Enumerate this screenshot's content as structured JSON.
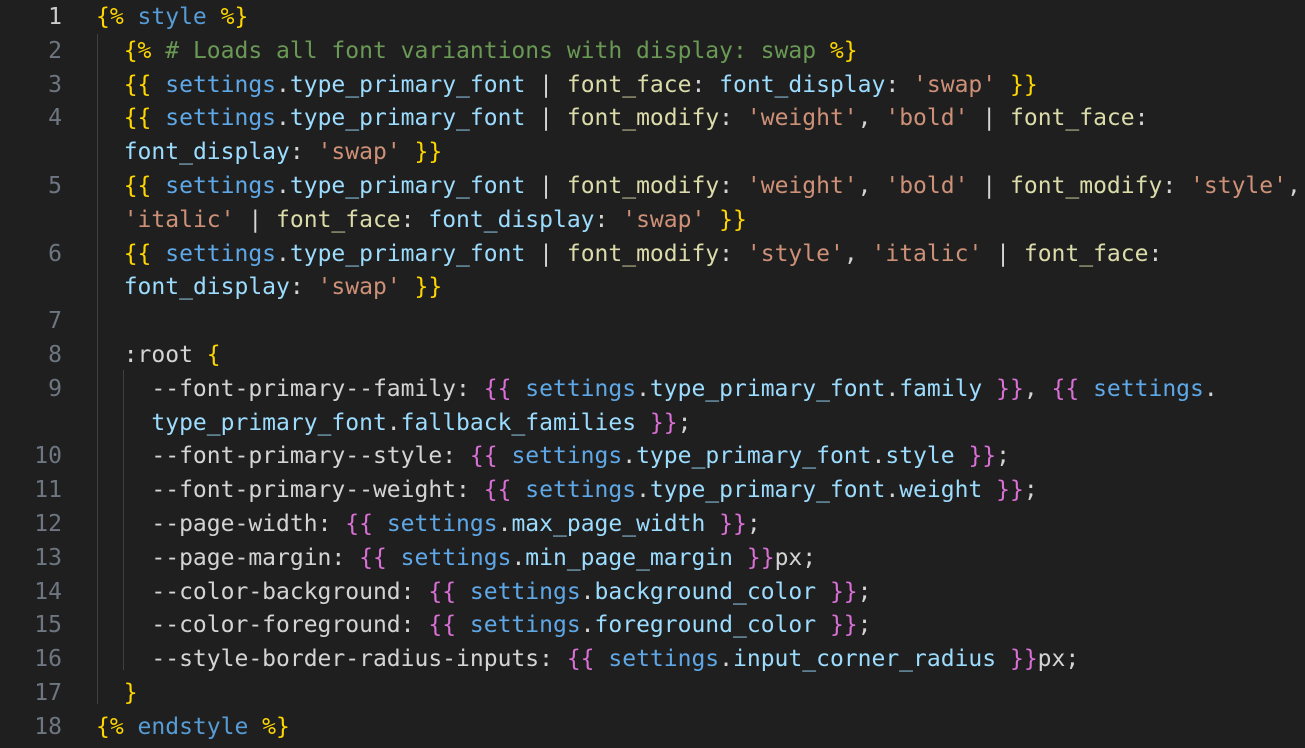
{
  "editor": {
    "colors": {
      "background": "#1f1f1f",
      "line_number": "#6e7681",
      "active_line_number": "#cccccc",
      "bracket_yellow": "#ffd700",
      "bracket_pink": "#da70d6",
      "keyword_blue": "#569cd6",
      "string": "#ce9178",
      "comment": "#6a9955"
    },
    "lines": [
      {
        "number": "1",
        "active": true,
        "tokens": [
          {
            "t": "{% ",
            "c": "c-yellow"
          },
          {
            "t": "style",
            "c": "c-blue"
          },
          {
            "t": " %}",
            "c": "c-yellow"
          }
        ]
      },
      {
        "number": "2",
        "tokens": [
          {
            "t": "  "
          },
          {
            "t": "{% ",
            "c": "c-yellow"
          },
          {
            "t": "# Loads all font variantions with display: swap",
            "c": "c-green"
          },
          {
            "t": " %}",
            "c": "c-yellow"
          }
        ]
      },
      {
        "number": "3",
        "tokens": [
          {
            "t": "  "
          },
          {
            "t": "{{ ",
            "c": "c-yellow"
          },
          {
            "t": "settings",
            "c": "c-var"
          },
          {
            "t": ".",
            "c": "c-white"
          },
          {
            "t": "type_primary_font",
            "c": "c-light"
          },
          {
            "t": " | ",
            "c": "c-white"
          },
          {
            "t": "font_face",
            "c": "c-filter"
          },
          {
            "t": ": ",
            "c": "c-white"
          },
          {
            "t": "font_display",
            "c": "c-light"
          },
          {
            "t": ": ",
            "c": "c-white"
          },
          {
            "t": "'swap'",
            "c": "c-string"
          },
          {
            "t": " }}",
            "c": "c-yellow"
          }
        ]
      },
      {
        "number": "4",
        "tokens": [
          {
            "t": "  "
          },
          {
            "t": "{{ ",
            "c": "c-yellow"
          },
          {
            "t": "settings",
            "c": "c-var"
          },
          {
            "t": ".",
            "c": "c-white"
          },
          {
            "t": "type_primary_font",
            "c": "c-light"
          },
          {
            "t": " | ",
            "c": "c-white"
          },
          {
            "t": "font_modify",
            "c": "c-filter"
          },
          {
            "t": ": ",
            "c": "c-white"
          },
          {
            "t": "'weight'",
            "c": "c-string"
          },
          {
            "t": ", ",
            "c": "c-white"
          },
          {
            "t": "'bold'",
            "c": "c-string"
          },
          {
            "t": " | ",
            "c": "c-white"
          },
          {
            "t": "font_face",
            "c": "c-filter"
          },
          {
            "t": ":",
            "c": "c-white"
          }
        ]
      },
      {
        "number": "",
        "tokens": [
          {
            "t": "  "
          },
          {
            "t": "font_display",
            "c": "c-light"
          },
          {
            "t": ": ",
            "c": "c-white"
          },
          {
            "t": "'swap'",
            "c": "c-string"
          },
          {
            "t": " }}",
            "c": "c-yellow"
          }
        ]
      },
      {
        "number": "5",
        "tokens": [
          {
            "t": "  "
          },
          {
            "t": "{{ ",
            "c": "c-yellow"
          },
          {
            "t": "settings",
            "c": "c-var"
          },
          {
            "t": ".",
            "c": "c-white"
          },
          {
            "t": "type_primary_font",
            "c": "c-light"
          },
          {
            "t": " | ",
            "c": "c-white"
          },
          {
            "t": "font_modify",
            "c": "c-filter"
          },
          {
            "t": ": ",
            "c": "c-white"
          },
          {
            "t": "'weight'",
            "c": "c-string"
          },
          {
            "t": ", ",
            "c": "c-white"
          },
          {
            "t": "'bold'",
            "c": "c-string"
          },
          {
            "t": " | ",
            "c": "c-white"
          },
          {
            "t": "font_modify",
            "c": "c-filter"
          },
          {
            "t": ": ",
            "c": "c-white"
          },
          {
            "t": "'style'",
            "c": "c-string"
          },
          {
            "t": ",",
            "c": "c-white"
          }
        ]
      },
      {
        "number": "",
        "tokens": [
          {
            "t": "  "
          },
          {
            "t": "'italic'",
            "c": "c-string"
          },
          {
            "t": " | ",
            "c": "c-white"
          },
          {
            "t": "font_face",
            "c": "c-filter"
          },
          {
            "t": ": ",
            "c": "c-white"
          },
          {
            "t": "font_display",
            "c": "c-light"
          },
          {
            "t": ": ",
            "c": "c-white"
          },
          {
            "t": "'swap'",
            "c": "c-string"
          },
          {
            "t": " }}",
            "c": "c-yellow"
          }
        ]
      },
      {
        "number": "6",
        "tokens": [
          {
            "t": "  "
          },
          {
            "t": "{{ ",
            "c": "c-yellow"
          },
          {
            "t": "settings",
            "c": "c-var"
          },
          {
            "t": ".",
            "c": "c-white"
          },
          {
            "t": "type_primary_font",
            "c": "c-light"
          },
          {
            "t": " | ",
            "c": "c-white"
          },
          {
            "t": "font_modify",
            "c": "c-filter"
          },
          {
            "t": ": ",
            "c": "c-white"
          },
          {
            "t": "'style'",
            "c": "c-string"
          },
          {
            "t": ", ",
            "c": "c-white"
          },
          {
            "t": "'italic'",
            "c": "c-string"
          },
          {
            "t": " | ",
            "c": "c-white"
          },
          {
            "t": "font_face",
            "c": "c-filter"
          },
          {
            "t": ":",
            "c": "c-white"
          }
        ]
      },
      {
        "number": "",
        "tokens": [
          {
            "t": "  "
          },
          {
            "t": "font_display",
            "c": "c-light"
          },
          {
            "t": ": ",
            "c": "c-white"
          },
          {
            "t": "'swap'",
            "c": "c-string"
          },
          {
            "t": " }}",
            "c": "c-yellow"
          }
        ]
      },
      {
        "number": "7",
        "tokens": []
      },
      {
        "number": "8",
        "tokens": [
          {
            "t": "  "
          },
          {
            "t": ":root",
            "c": "c-white"
          },
          {
            "t": " {",
            "c": "c-yellow"
          }
        ]
      },
      {
        "number": "9",
        "tokens": [
          {
            "t": "    "
          },
          {
            "t": "--font-primary--family",
            "c": "c-white"
          },
          {
            "t": ": ",
            "c": "c-white"
          },
          {
            "t": "{{ ",
            "c": "c-pink"
          },
          {
            "t": "settings",
            "c": "c-var"
          },
          {
            "t": ".",
            "c": "c-white"
          },
          {
            "t": "type_primary_font",
            "c": "c-light"
          },
          {
            "t": ".",
            "c": "c-white"
          },
          {
            "t": "family",
            "c": "c-light"
          },
          {
            "t": " }}",
            "c": "c-pink"
          },
          {
            "t": ", ",
            "c": "c-white"
          },
          {
            "t": "{{ ",
            "c": "c-pink"
          },
          {
            "t": "settings",
            "c": "c-var"
          },
          {
            "t": ".",
            "c": "c-white"
          }
        ]
      },
      {
        "number": "",
        "tokens": [
          {
            "t": "    "
          },
          {
            "t": "type_primary_font",
            "c": "c-light"
          },
          {
            "t": ".",
            "c": "c-white"
          },
          {
            "t": "fallback_families",
            "c": "c-light"
          },
          {
            "t": " }}",
            "c": "c-pink"
          },
          {
            "t": ";",
            "c": "c-white"
          }
        ]
      },
      {
        "number": "10",
        "tokens": [
          {
            "t": "    "
          },
          {
            "t": "--font-primary--style",
            "c": "c-white"
          },
          {
            "t": ": ",
            "c": "c-white"
          },
          {
            "t": "{{ ",
            "c": "c-pink"
          },
          {
            "t": "settings",
            "c": "c-var"
          },
          {
            "t": ".",
            "c": "c-white"
          },
          {
            "t": "type_primary_font",
            "c": "c-light"
          },
          {
            "t": ".",
            "c": "c-white"
          },
          {
            "t": "style",
            "c": "c-light"
          },
          {
            "t": " }}",
            "c": "c-pink"
          },
          {
            "t": ";",
            "c": "c-white"
          }
        ]
      },
      {
        "number": "11",
        "tokens": [
          {
            "t": "    "
          },
          {
            "t": "--font-primary--weight",
            "c": "c-white"
          },
          {
            "t": ": ",
            "c": "c-white"
          },
          {
            "t": "{{ ",
            "c": "c-pink"
          },
          {
            "t": "settings",
            "c": "c-var"
          },
          {
            "t": ".",
            "c": "c-white"
          },
          {
            "t": "type_primary_font",
            "c": "c-light"
          },
          {
            "t": ".",
            "c": "c-white"
          },
          {
            "t": "weight",
            "c": "c-light"
          },
          {
            "t": " }}",
            "c": "c-pink"
          },
          {
            "t": ";",
            "c": "c-white"
          }
        ]
      },
      {
        "number": "12",
        "tokens": [
          {
            "t": "    "
          },
          {
            "t": "--page-width",
            "c": "c-white"
          },
          {
            "t": ": ",
            "c": "c-white"
          },
          {
            "t": "{{ ",
            "c": "c-pink"
          },
          {
            "t": "settings",
            "c": "c-var"
          },
          {
            "t": ".",
            "c": "c-white"
          },
          {
            "t": "max_page_width",
            "c": "c-light"
          },
          {
            "t": " }}",
            "c": "c-pink"
          },
          {
            "t": ";",
            "c": "c-white"
          }
        ]
      },
      {
        "number": "13",
        "tokens": [
          {
            "t": "    "
          },
          {
            "t": "--page-margin",
            "c": "c-white"
          },
          {
            "t": ": ",
            "c": "c-white"
          },
          {
            "t": "{{ ",
            "c": "c-pink"
          },
          {
            "t": "settings",
            "c": "c-var"
          },
          {
            "t": ".",
            "c": "c-white"
          },
          {
            "t": "min_page_margin",
            "c": "c-light"
          },
          {
            "t": " }}",
            "c": "c-pink"
          },
          {
            "t": "px;",
            "c": "c-white"
          }
        ]
      },
      {
        "number": "14",
        "tokens": [
          {
            "t": "    "
          },
          {
            "t": "--color-background",
            "c": "c-white"
          },
          {
            "t": ": ",
            "c": "c-white"
          },
          {
            "t": "{{ ",
            "c": "c-pink"
          },
          {
            "t": "settings",
            "c": "c-var"
          },
          {
            "t": ".",
            "c": "c-white"
          },
          {
            "t": "background_color",
            "c": "c-light"
          },
          {
            "t": " }}",
            "c": "c-pink"
          },
          {
            "t": ";",
            "c": "c-white"
          }
        ]
      },
      {
        "number": "15",
        "tokens": [
          {
            "t": "    "
          },
          {
            "t": "--color-foreground",
            "c": "c-white"
          },
          {
            "t": ": ",
            "c": "c-white"
          },
          {
            "t": "{{ ",
            "c": "c-pink"
          },
          {
            "t": "settings",
            "c": "c-var"
          },
          {
            "t": ".",
            "c": "c-white"
          },
          {
            "t": "foreground_color",
            "c": "c-light"
          },
          {
            "t": " }}",
            "c": "c-pink"
          },
          {
            "t": ";",
            "c": "c-white"
          }
        ]
      },
      {
        "number": "16",
        "tokens": [
          {
            "t": "    "
          },
          {
            "t": "--style-border-radius-inputs",
            "c": "c-white"
          },
          {
            "t": ": ",
            "c": "c-white"
          },
          {
            "t": "{{ ",
            "c": "c-pink"
          },
          {
            "t": "settings",
            "c": "c-var"
          },
          {
            "t": ".",
            "c": "c-white"
          },
          {
            "t": "input_corner_radius",
            "c": "c-light"
          },
          {
            "t": " }}",
            "c": "c-pink"
          },
          {
            "t": "px;",
            "c": "c-white"
          }
        ]
      },
      {
        "number": "17",
        "tokens": [
          {
            "t": "  "
          },
          {
            "t": "}",
            "c": "c-yellow"
          }
        ]
      },
      {
        "number": "18",
        "tokens": [
          {
            "t": "{% ",
            "c": "c-yellow"
          },
          {
            "t": "endstyle",
            "c": "c-blue"
          },
          {
            "t": " %}",
            "c": "c-yellow"
          }
        ]
      }
    ]
  }
}
